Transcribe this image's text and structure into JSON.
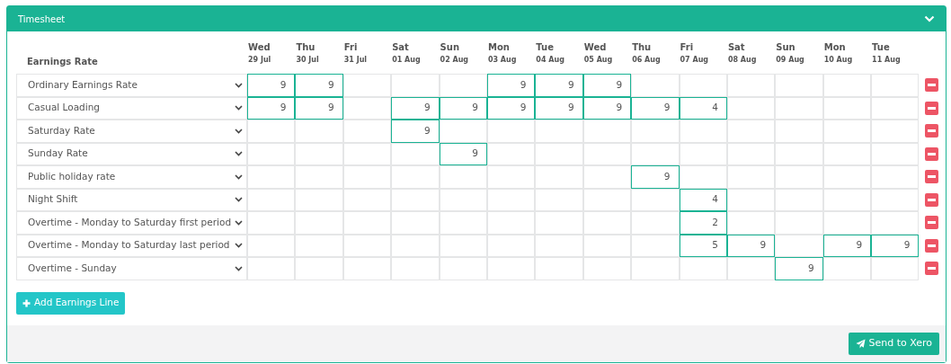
{
  "panel": {
    "title": "Timesheet",
    "collapsed": false
  },
  "table": {
    "rate_heading": "Earnings Rate",
    "days": [
      {
        "day": "Wed",
        "date": "29 Jul"
      },
      {
        "day": "Thu",
        "date": "30 Jul"
      },
      {
        "day": "Fri",
        "date": "31 Jul"
      },
      {
        "day": "Sat",
        "date": "01 Aug"
      },
      {
        "day": "Sun",
        "date": "02 Aug"
      },
      {
        "day": "Mon",
        "date": "03 Aug"
      },
      {
        "day": "Tue",
        "date": "04 Aug"
      },
      {
        "day": "Wed",
        "date": "05 Aug"
      },
      {
        "day": "Thu",
        "date": "06 Aug"
      },
      {
        "day": "Fri",
        "date": "07 Aug"
      },
      {
        "day": "Sat",
        "date": "08 Aug"
      },
      {
        "day": "Sun",
        "date": "09 Aug"
      },
      {
        "day": "Mon",
        "date": "10 Aug"
      },
      {
        "day": "Tue",
        "date": "11 Aug"
      }
    ],
    "rows": [
      {
        "rate": "Ordinary Earnings Rate",
        "cells": [
          {
            "filled": true,
            "value": "9"
          },
          {
            "filled": true,
            "value": "9"
          },
          {
            "filled": false
          },
          {
            "filled": false
          },
          {
            "filled": false
          },
          {
            "filled": true,
            "value": "9"
          },
          {
            "filled": true,
            "value": "9"
          },
          {
            "filled": true,
            "value": "9"
          },
          {
            "filled": false
          },
          {
            "filled": false
          },
          {
            "filled": false
          },
          {
            "filled": false
          },
          {
            "filled": false
          },
          {
            "filled": false
          }
        ]
      },
      {
        "rate": "Casual Loading",
        "cells": [
          {
            "filled": true,
            "value": "9"
          },
          {
            "filled": true,
            "value": "9"
          },
          {
            "filled": false
          },
          {
            "filled": true,
            "value": "9"
          },
          {
            "filled": true,
            "value": "9"
          },
          {
            "filled": true,
            "value": "9"
          },
          {
            "filled": true,
            "value": "9"
          },
          {
            "filled": true,
            "value": "9"
          },
          {
            "filled": true,
            "value": "9"
          },
          {
            "filled": true,
            "value": "4"
          },
          {
            "filled": false
          },
          {
            "filled": false
          },
          {
            "filled": false
          },
          {
            "filled": false
          }
        ]
      },
      {
        "rate": "Saturday Rate",
        "cells": [
          {
            "filled": false
          },
          {
            "filled": false
          },
          {
            "filled": false
          },
          {
            "filled": true,
            "value": "9"
          },
          {
            "filled": false
          },
          {
            "filled": false
          },
          {
            "filled": false
          },
          {
            "filled": false
          },
          {
            "filled": false
          },
          {
            "filled": false
          },
          {
            "filled": false
          },
          {
            "filled": false
          },
          {
            "filled": false
          },
          {
            "filled": false
          }
        ]
      },
      {
        "rate": "Sunday Rate",
        "cells": [
          {
            "filled": false
          },
          {
            "filled": false
          },
          {
            "filled": false
          },
          {
            "filled": false
          },
          {
            "filled": true,
            "value": "9"
          },
          {
            "filled": false
          },
          {
            "filled": false
          },
          {
            "filled": false
          },
          {
            "filled": false
          },
          {
            "filled": false
          },
          {
            "filled": false
          },
          {
            "filled": false
          },
          {
            "filled": false
          },
          {
            "filled": false
          }
        ]
      },
      {
        "rate": "Public holiday rate",
        "cells": [
          {
            "filled": false
          },
          {
            "filled": false
          },
          {
            "filled": false
          },
          {
            "filled": false
          },
          {
            "filled": false
          },
          {
            "filled": false
          },
          {
            "filled": false
          },
          {
            "filled": false
          },
          {
            "filled": true,
            "value": "9"
          },
          {
            "filled": false
          },
          {
            "filled": false
          },
          {
            "filled": false
          },
          {
            "filled": false
          },
          {
            "filled": false
          }
        ]
      },
      {
        "rate": "Night Shift",
        "cells": [
          {
            "filled": false
          },
          {
            "filled": false
          },
          {
            "filled": false
          },
          {
            "filled": false
          },
          {
            "filled": false
          },
          {
            "filled": false
          },
          {
            "filled": false
          },
          {
            "filled": false
          },
          {
            "filled": false
          },
          {
            "filled": true,
            "value": "4"
          },
          {
            "filled": false
          },
          {
            "filled": false
          },
          {
            "filled": false
          },
          {
            "filled": false
          }
        ]
      },
      {
        "rate": "Overtime - Monday to Saturday first period",
        "cells": [
          {
            "filled": false
          },
          {
            "filled": false
          },
          {
            "filled": false
          },
          {
            "filled": false
          },
          {
            "filled": false
          },
          {
            "filled": false
          },
          {
            "filled": false
          },
          {
            "filled": false
          },
          {
            "filled": false
          },
          {
            "filled": true,
            "value": "2"
          },
          {
            "filled": false
          },
          {
            "filled": false
          },
          {
            "filled": false
          },
          {
            "filled": false
          }
        ]
      },
      {
        "rate": "Overtime - Monday to Saturday last period",
        "cells": [
          {
            "filled": false
          },
          {
            "filled": false
          },
          {
            "filled": false
          },
          {
            "filled": false
          },
          {
            "filled": false
          },
          {
            "filled": false
          },
          {
            "filled": false
          },
          {
            "filled": false
          },
          {
            "filled": false
          },
          {
            "filled": true,
            "value": "5"
          },
          {
            "filled": true,
            "value": "9"
          },
          {
            "filled": false
          },
          {
            "filled": true,
            "value": "9"
          },
          {
            "filled": true,
            "value": "9"
          }
        ]
      },
      {
        "rate": "Overtime - Sunday",
        "cells": [
          {
            "filled": false
          },
          {
            "filled": false
          },
          {
            "filled": false
          },
          {
            "filled": false
          },
          {
            "filled": false
          },
          {
            "filled": false
          },
          {
            "filled": false
          },
          {
            "filled": false
          },
          {
            "filled": false
          },
          {
            "filled": false
          },
          {
            "filled": false
          },
          {
            "filled": true,
            "value": "9"
          },
          {
            "filled": false
          },
          {
            "filled": false
          }
        ]
      }
    ]
  },
  "add_button": "Add Earnings Line",
  "send_button": "Send to Xero"
}
